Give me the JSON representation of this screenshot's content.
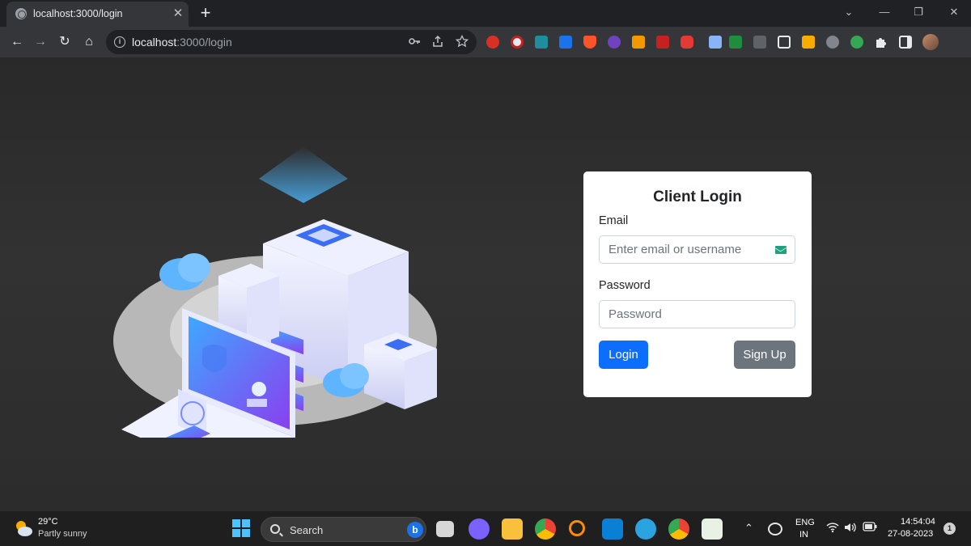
{
  "browser": {
    "tab": {
      "title": "localhost:3000/login",
      "close_glyph": "✕"
    },
    "newtab_glyph": "+",
    "window_controls": [
      "⌄",
      "—",
      "❐",
      "✕"
    ],
    "nav": {
      "back": "←",
      "forward": "→",
      "reload": "↻",
      "home": "⌂"
    },
    "omnibox": {
      "info_glyph": "i",
      "host": "localhost",
      "rest": ":3000/login"
    },
    "omnibox_icons": [
      "key-icon",
      "share-icon",
      "star-icon"
    ],
    "extensions": [
      "extension-red-icon",
      "extension-grey-icon",
      "extension-teal-icon",
      "extension-blue-icon",
      "extension-brave-icon",
      "extension-purple-icon",
      "extension-orange-icon",
      "extension-red2-icon",
      "extension-youtube-icon",
      "extension-pen-icon",
      "extension-folder-icon",
      "extension-n-icon",
      "extension-crop-icon",
      "extension-image-icon",
      "extension-db-icon",
      "extension-green-icon",
      "puzzle-icon",
      "sidepanel-icon",
      "profile-avatar-icon"
    ]
  },
  "login": {
    "title": "Client Login",
    "email_label": "Email",
    "email_placeholder": "Enter email or username",
    "password_label": "Password",
    "password_placeholder": "Password",
    "login_button": "Login",
    "signup_button": "Sign Up"
  },
  "colors": {
    "primary": "#0d6efd",
    "secondary": "#6c757d",
    "mail_icon": "#20a080"
  },
  "taskbar": {
    "weather_temp": "29°C",
    "weather_desc": "Partly sunny",
    "search_label": "Search",
    "search_bing": "b",
    "apps": [
      "task-view-icon",
      "chat-icon",
      "file-explorer-icon",
      "chrome-icon",
      "search-app-icon",
      "vscode-icon",
      "telegram-icon",
      "chrome-active-icon",
      "notepad-icon"
    ],
    "tray_chevron": "⌃",
    "lang_line1": "ENG",
    "lang_line2": "IN",
    "time": "14:54:04",
    "date": "27-08-2023",
    "notifications": "1"
  }
}
